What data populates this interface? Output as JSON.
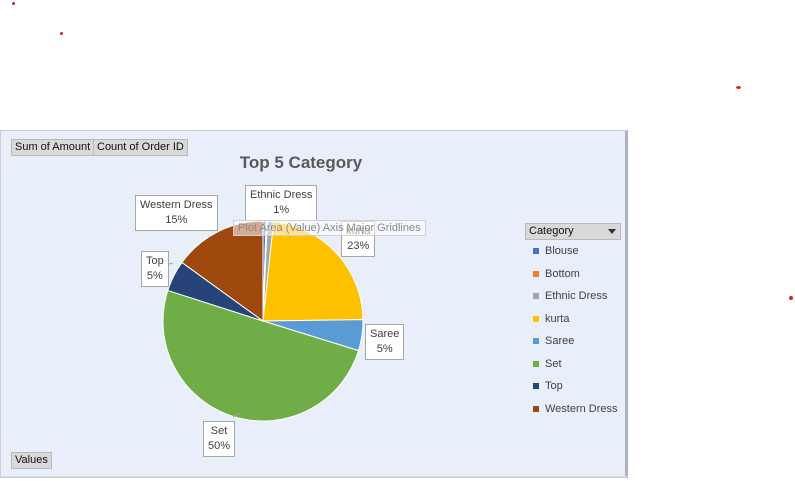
{
  "fields": {
    "values_btn_1": "Sum of Amount",
    "values_btn_2": "Count of Order ID",
    "values_area": "Values"
  },
  "tooltip": "Plot Area (Value) Axis Major Gridlines",
  "legend": {
    "title": "Category"
  },
  "colors": {
    "Blouse": "#4472c4",
    "Bottom": "#ed7d31",
    "Ethnic Dress": "#a5a5a5",
    "kurta": "#ffc000",
    "Saree": "#5b9bd5",
    "Set": "#70ad47",
    "Top": "#264478",
    "Western Dress": "#9e480e"
  },
  "chart_data": {
    "type": "pie",
    "title": "Top 5 Category",
    "categories": [
      "Blouse",
      "Bottom",
      "Ethnic Dress",
      "kurta",
      "Saree",
      "Set",
      "Top",
      "Western Dress"
    ],
    "values": [
      0.5,
      0.2,
      1,
      23,
      5,
      50,
      5,
      15
    ],
    "data_labels": [
      {
        "category": "Ethnic Dress",
        "percent": "1%"
      },
      {
        "category": "kurta",
        "percent": "23%"
      },
      {
        "category": "Saree",
        "percent": "5%"
      },
      {
        "category": "Set",
        "percent": "50%"
      },
      {
        "category": "Top",
        "percent": "5%"
      },
      {
        "category": "Western Dress",
        "percent": "15%"
      }
    ],
    "legend_position": "right"
  }
}
